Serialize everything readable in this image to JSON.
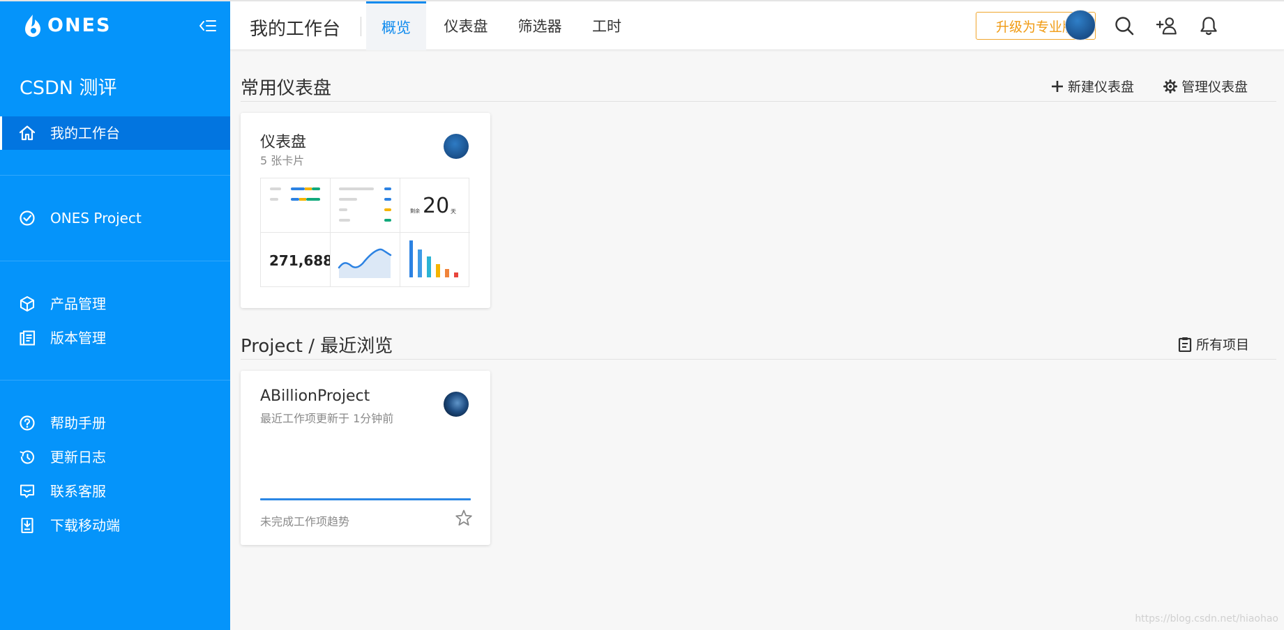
{
  "app": {
    "logo_text": "ONES"
  },
  "sidebar": {
    "team_name": "CSDN 测评",
    "items": [
      {
        "label": "我的工作台",
        "icon": "home-icon"
      },
      {
        "label": "ONES Project",
        "icon": "check-circle-icon"
      },
      {
        "label": "产品管理",
        "icon": "cube-icon"
      },
      {
        "label": "版本管理",
        "icon": "version-icon"
      },
      {
        "label": "帮助手册",
        "icon": "help-icon"
      },
      {
        "label": "更新日志",
        "icon": "history-icon"
      },
      {
        "label": "联系客服",
        "icon": "message-icon"
      },
      {
        "label": "下载移动端",
        "icon": "download-icon"
      }
    ]
  },
  "header": {
    "title": "我的工作台",
    "tabs": [
      {
        "label": "概览"
      },
      {
        "label": "仪表盘"
      },
      {
        "label": "筛选器"
      },
      {
        "label": "工时"
      }
    ],
    "upgrade_label": "升级为专业版"
  },
  "dashboards": {
    "title": "常用仪表盘",
    "new_label": "新建仪表盘",
    "manage_label": "管理仪表盘",
    "card": {
      "title": "仪表盘",
      "subtitle": "5 张卡片",
      "number": "271,688",
      "remain_label": "剩余",
      "remain_value": "20",
      "remain_unit": "天"
    }
  },
  "projects": {
    "title": "Project / 最近浏览",
    "all_label": "所有项目",
    "card": {
      "title": "ABillionProject",
      "subtitle": "最近工作项更新于 1分钟前",
      "trend_label": "未完成工作项趋势"
    }
  },
  "watermark": "https://blog.csdn.net/hiaohao",
  "colors": {
    "sidebar": "#0594fa",
    "sidebar_active": "#0275e0",
    "accent": "#0e8aee",
    "upgrade": "#f09a12"
  }
}
